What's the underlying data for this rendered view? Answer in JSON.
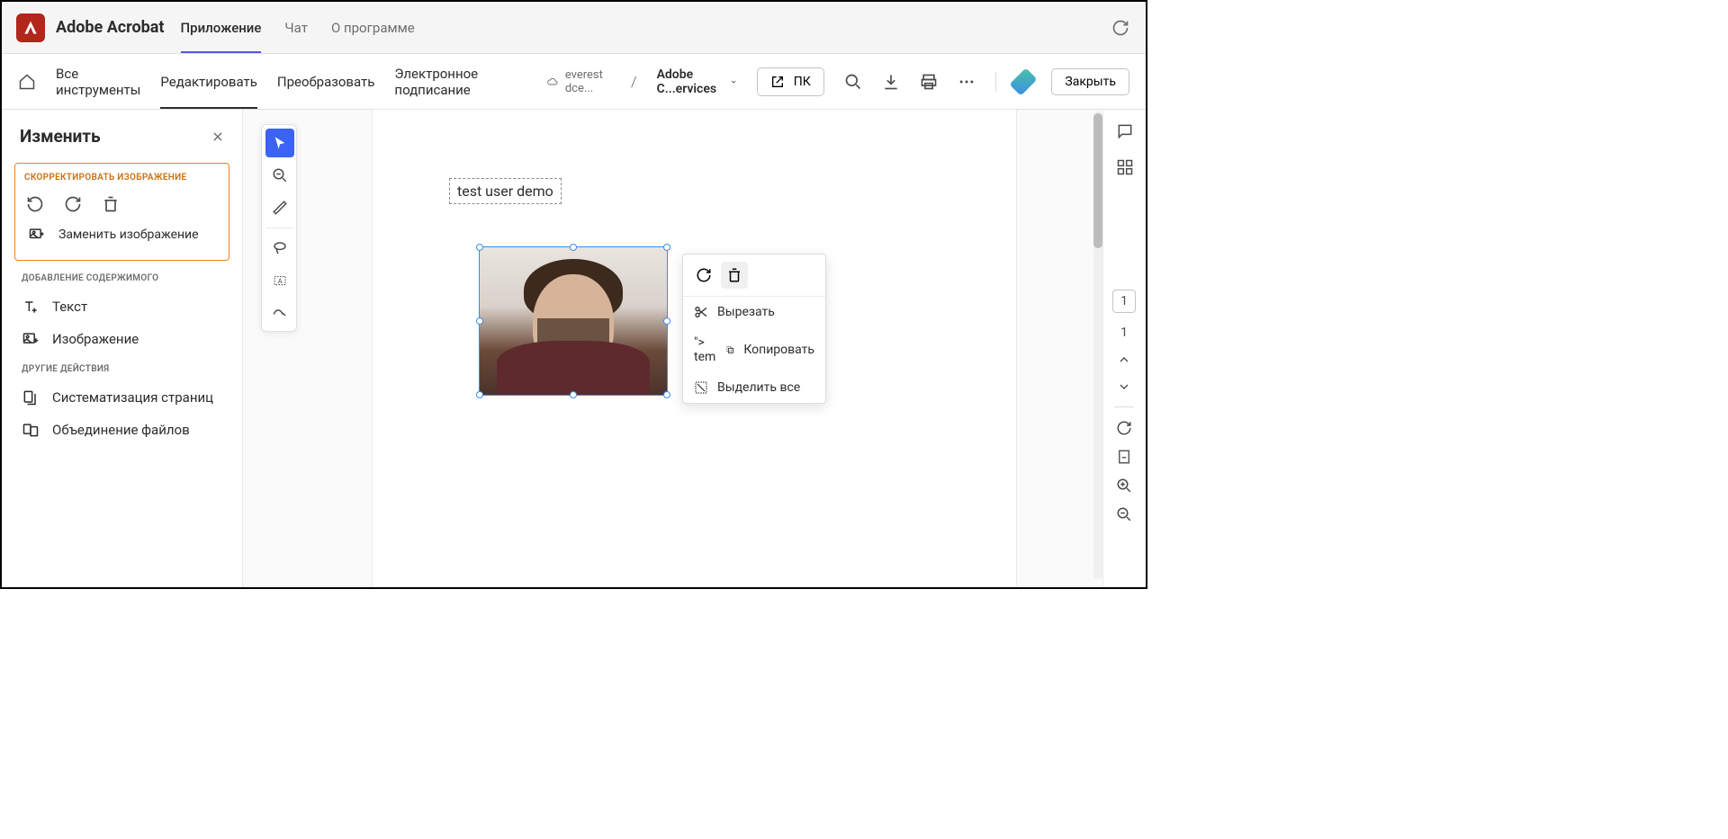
{
  "app": {
    "title": "Adobe Acrobat"
  },
  "topTabs": {
    "app": "Приложение",
    "chat": "Чат",
    "about": "О программе"
  },
  "toolbarTabs": {
    "allTools": "Все инструменты",
    "edit": "Редактировать",
    "convert": "Преобразовать",
    "sign": "Электронное подписание"
  },
  "cloud": {
    "location": "everest dce..."
  },
  "breadcrumb": {
    "sep": "/",
    "doc": "Adobe C...ervices"
  },
  "desktopBtn": {
    "label": "ПК"
  },
  "closeBtn": {
    "label": "Закрыть"
  },
  "leftPanel": {
    "title": "Изменить",
    "sections": {
      "adjust": "СКОРРЕКТИРОВАТЬ ИЗОБРАЖЕНИЕ",
      "replace": "Заменить изображение",
      "addContent": "ДОБАВЛЕНИЕ СОДЕРЖИМОГО",
      "text": "Текст",
      "image": "Изображение",
      "otherActions": "ДРУГИЕ ДЕЙСТВИЯ",
      "organize": "Систематизация страниц",
      "combine": "Объединение файлов"
    }
  },
  "canvas": {
    "textBox": "test user demo"
  },
  "ctx": {
    "cut": "Вырезать",
    "copy": "Копировать",
    "selectAll": "Выделить все"
  },
  "pageNav": {
    "current": "1",
    "total": "1"
  }
}
